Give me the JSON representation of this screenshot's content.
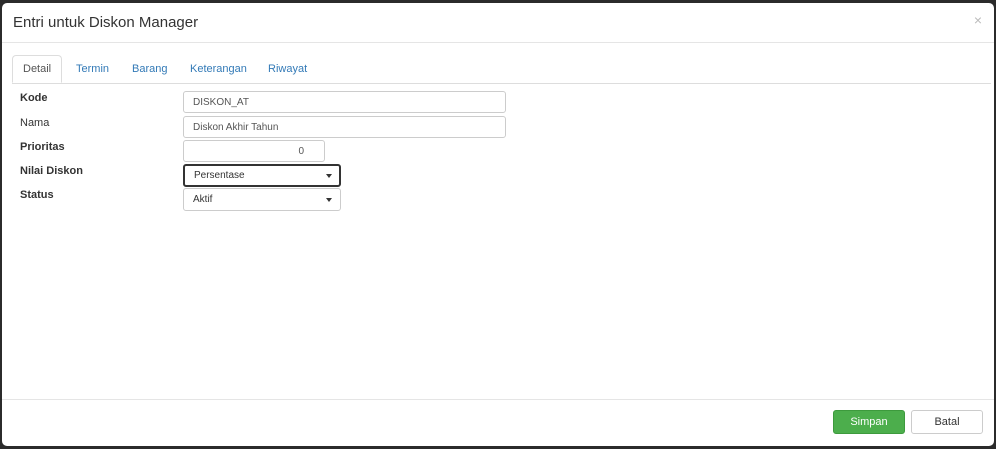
{
  "modal": {
    "title": "Entri untuk Diskon Manager",
    "close_label": "×"
  },
  "tabs": [
    {
      "label": "Detail",
      "active": true
    },
    {
      "label": "Termin",
      "active": false
    },
    {
      "label": "Barang",
      "active": false
    },
    {
      "label": "Keterangan",
      "active": false
    },
    {
      "label": "Riwayat",
      "active": false
    }
  ],
  "form": {
    "kode": {
      "label": "Kode",
      "value": "DISKON_AT"
    },
    "nama": {
      "label": "Nama",
      "value": "Diskon Akhir Tahun"
    },
    "prioritas": {
      "label": "Prioritas",
      "value": "0"
    },
    "nilai_diskon": {
      "label": "Nilai Diskon",
      "value": "Persentase"
    },
    "status": {
      "label": "Status",
      "value": "Aktif"
    }
  },
  "footer": {
    "save_label": "Simpan",
    "cancel_label": "Batal"
  },
  "colors": {
    "save_button": "#4cae4c",
    "tab_link": "#337ab7"
  }
}
